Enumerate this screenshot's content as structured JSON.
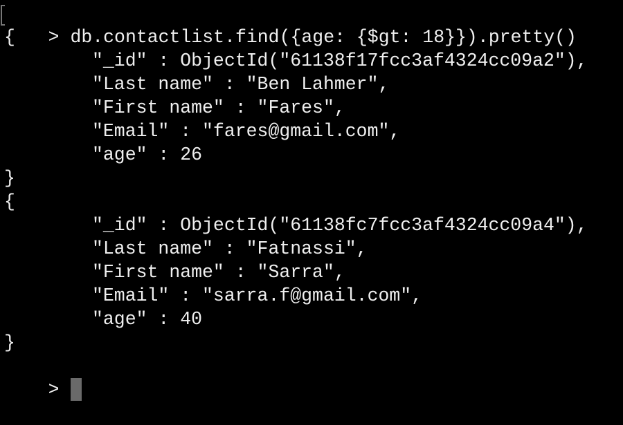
{
  "terminal": {
    "prompt": ">",
    "command": "db.contactlist.find({age: {$gt: 18}}).pretty()",
    "documents": [
      {
        "open": "{",
        "fields": [
          "\"_id\" : ObjectId(\"61138f17fcc3af4324cc09a2\"),",
          "\"Last name\" : \"Ben Lahmer\",",
          "\"First name\" : \"Fares\",",
          "\"Email\" : \"fares@gmail.com\",",
          "\"age\" : 26"
        ],
        "close": "}"
      },
      {
        "open": "{",
        "fields": [
          "\"_id\" : ObjectId(\"61138fc7fcc3af4324cc09a4\"),",
          "\"Last name\" : \"Fatnassi\",",
          "\"First name\" : \"Sarra\",",
          "\"Email\" : \"sarra.f@gmail.com\",",
          "\"age\" : 40"
        ],
        "close": "}"
      }
    ],
    "final_prompt": ">"
  }
}
